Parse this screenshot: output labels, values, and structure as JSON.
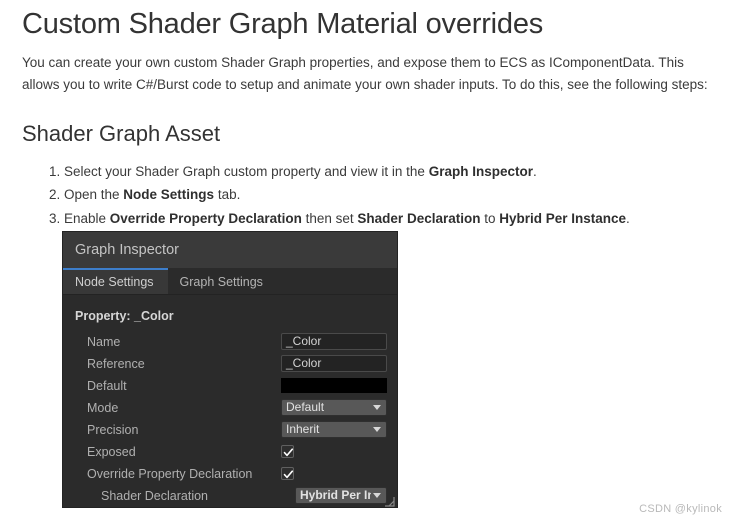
{
  "page": {
    "title": "Custom Shader Graph Material overrides",
    "intro": "You can create your own custom Shader Graph properties, and expose them to ECS as IComponentData. This allows you to write C#/Burst code to setup and animate your own shader inputs. To do this, see the following steps:",
    "section_title": "Shader Graph Asset"
  },
  "steps": [
    {
      "parts": [
        {
          "text": "Select your Shader Graph custom property and view it in the ",
          "bold": false
        },
        {
          "text": "Graph Inspector",
          "bold": true
        },
        {
          "text": ".",
          "bold": false
        }
      ]
    },
    {
      "parts": [
        {
          "text": "Open the ",
          "bold": false
        },
        {
          "text": "Node Settings",
          "bold": true
        },
        {
          "text": " tab.",
          "bold": false
        }
      ]
    },
    {
      "parts": [
        {
          "text": "Enable ",
          "bold": false
        },
        {
          "text": "Override Property Declaration",
          "bold": true
        },
        {
          "text": " then set ",
          "bold": false
        },
        {
          "text": "Shader Declaration",
          "bold": true
        },
        {
          "text": " to ",
          "bold": false
        },
        {
          "text": "Hybrid Per Instance",
          "bold": true
        },
        {
          "text": ".",
          "bold": false
        }
      ]
    }
  ],
  "inspector": {
    "header_title": "Graph Inspector",
    "tabs": [
      {
        "label": "Node Settings",
        "active": true
      },
      {
        "label": "Graph Settings",
        "active": false
      }
    ],
    "property_heading": "Property: _Color",
    "rows": [
      {
        "label": "Name",
        "type": "text",
        "value": "_Color",
        "indent": 1
      },
      {
        "label": "Reference",
        "type": "text",
        "value": "_Color",
        "indent": 1
      },
      {
        "label": "Default",
        "type": "color",
        "value": "#000000",
        "indent": 1
      },
      {
        "label": "Mode",
        "type": "dropdown",
        "value": "Default",
        "indent": 1,
        "bold": false
      },
      {
        "label": "Precision",
        "type": "dropdown",
        "value": "Inherit",
        "indent": 1,
        "bold": false
      },
      {
        "label": "Exposed",
        "type": "checkbox",
        "value": true,
        "indent": 1
      },
      {
        "label": "Override Property Declaration",
        "type": "checkbox",
        "value": true,
        "indent": 1
      },
      {
        "label": "Shader Declaration",
        "type": "dropdown",
        "value": "Hybrid Per Instar",
        "indent": 2,
        "bold": true
      }
    ]
  },
  "watermark": "CSDN @kylinok",
  "colors": {
    "tab_accent": "#3d7ecb",
    "panel_header_bg": "#3a3a3a",
    "panel_bg": "#2b2b2b",
    "swatch": "#000000"
  }
}
